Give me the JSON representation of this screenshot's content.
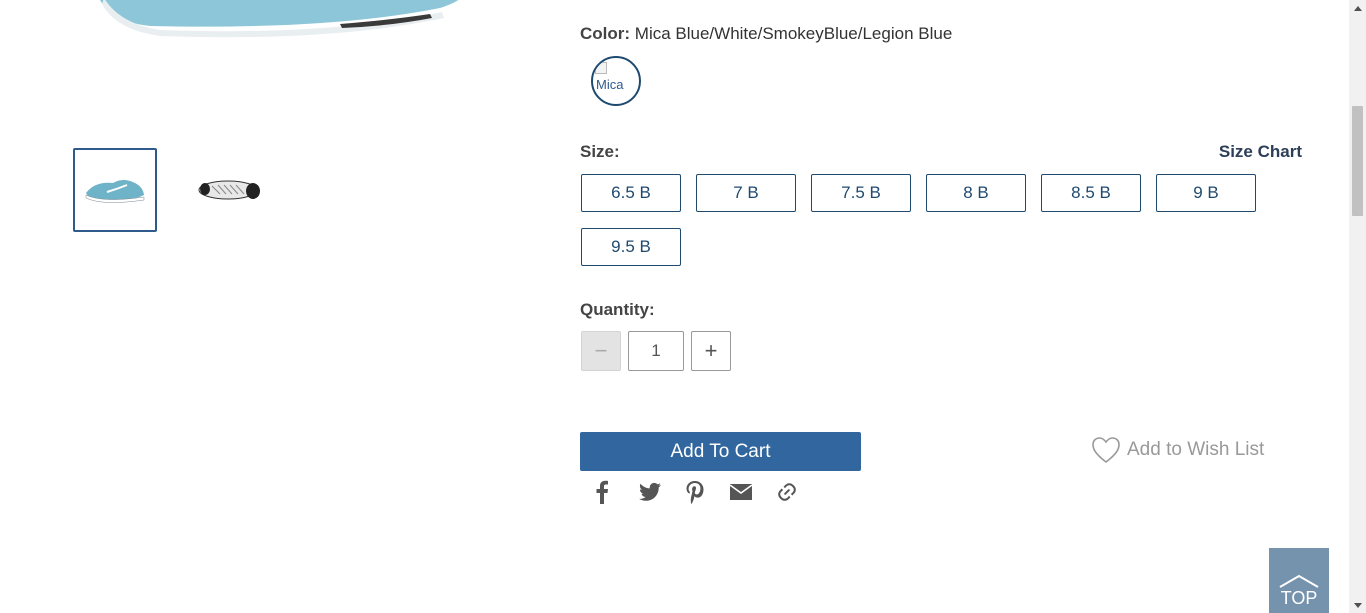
{
  "color": {
    "label": "Color:",
    "value": "Mica Blue/White/SmokeyBlue/Legion Blue",
    "swatch_alt": "Mica"
  },
  "size": {
    "label": "Size:",
    "chart_link": "Size Chart",
    "options": [
      "6.5 B",
      "7 B",
      "7.5 B",
      "8 B",
      "8.5 B",
      "9 B",
      "9.5 B"
    ]
  },
  "quantity": {
    "label": "Quantity:",
    "value": "1",
    "minus_symbol": "−",
    "plus_symbol": "+"
  },
  "actions": {
    "add_to_cart": "Add To Cart",
    "wish_list": "Add to Wish List"
  },
  "share": [
    "facebook-icon",
    "twitter-icon",
    "pinterest-icon",
    "email-icon",
    "link-icon"
  ],
  "top_button": "TOP",
  "colors": {
    "primary": "#31669e",
    "border_dark": "#1f4a70",
    "top_button": "#7593ad"
  }
}
